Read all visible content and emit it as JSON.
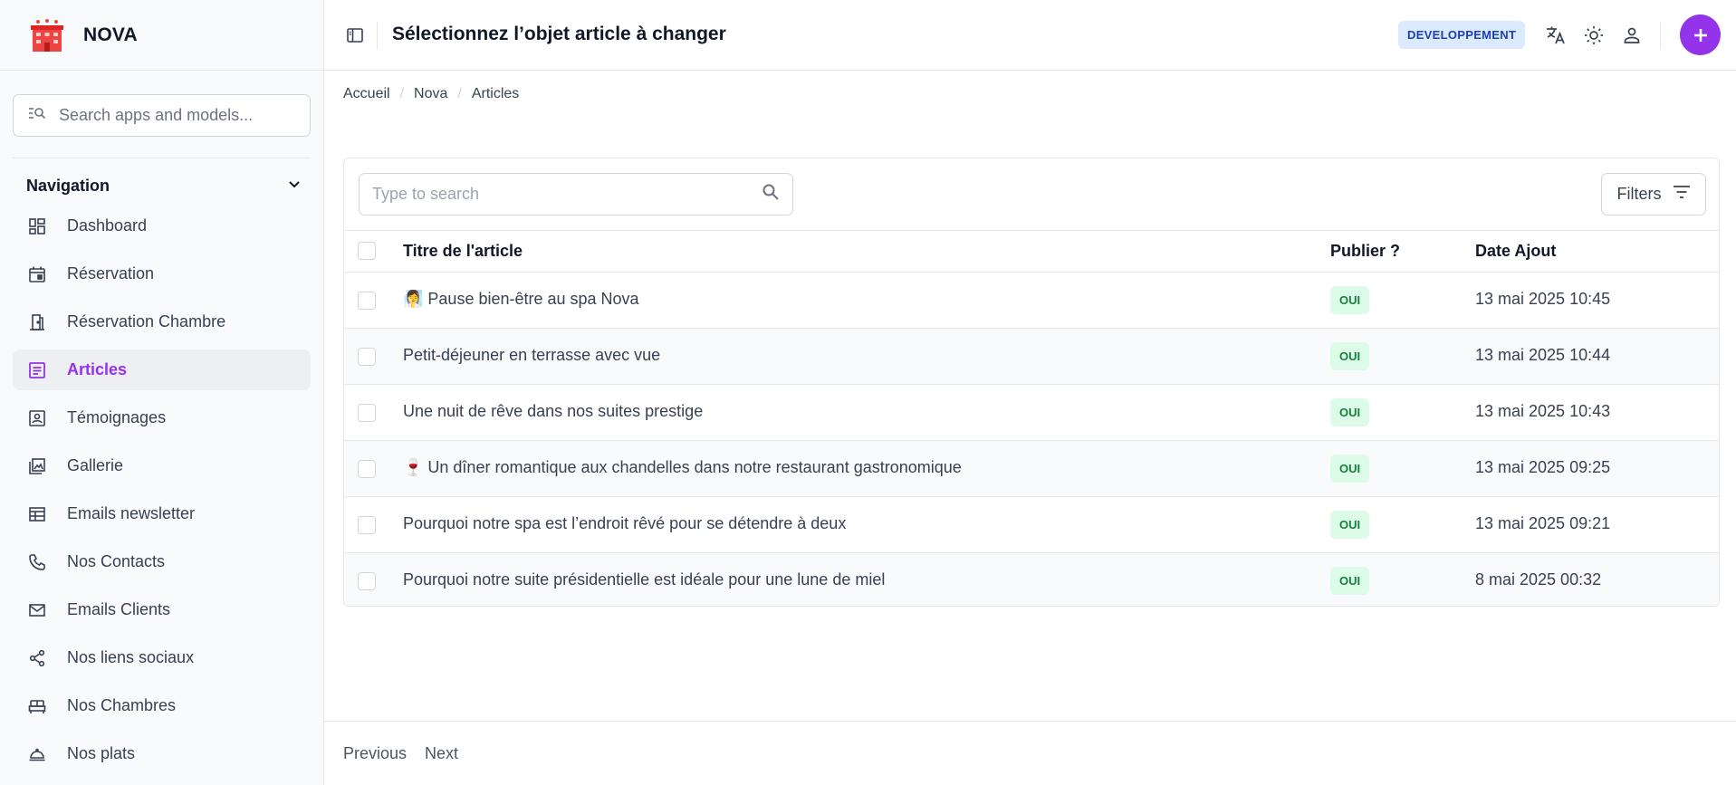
{
  "app": {
    "name": "NOVA"
  },
  "sidebar": {
    "search_placeholder": "Search apps and models...",
    "nav_heading": "Navigation",
    "items": [
      {
        "label": "Dashboard",
        "icon": "dashboard-icon",
        "active": false
      },
      {
        "label": "Réservation",
        "icon": "calendar-icon",
        "active": false
      },
      {
        "label": "Réservation Chambre",
        "icon": "door-icon",
        "active": false
      },
      {
        "label": "Articles",
        "icon": "article-icon",
        "active": true
      },
      {
        "label": "Témoignages",
        "icon": "contact-card-icon",
        "active": false
      },
      {
        "label": "Gallerie",
        "icon": "gallery-icon",
        "active": false
      },
      {
        "label": "Emails newsletter",
        "icon": "table-icon",
        "active": false
      },
      {
        "label": "Nos Contacts",
        "icon": "phone-icon",
        "active": false
      },
      {
        "label": "Emails Clients",
        "icon": "mail-icon",
        "active": false
      },
      {
        "label": "Nos liens sociaux",
        "icon": "share-icon",
        "active": false
      },
      {
        "label": "Nos Chambres",
        "icon": "bed-icon",
        "active": false
      },
      {
        "label": "Nos plats",
        "icon": "dish-icon",
        "active": false
      }
    ]
  },
  "header": {
    "title": "Sélectionnez l’objet article à changer",
    "env_badge": "DEVELOPPEMENT"
  },
  "breadcrumb": [
    "Accueil",
    "Nova",
    "Articles"
  ],
  "table": {
    "search_placeholder": "Type to search",
    "filters_label": "Filters",
    "columns": [
      "Titre de l'article",
      "Publier ?",
      "Date Ajout"
    ],
    "rows": [
      {
        "title": "🧖‍♀️ Pause bien-être au spa Nova",
        "published": "OUI",
        "date": "13 mai 2025 10:45"
      },
      {
        "title": "Petit-déjeuner en terrasse avec vue",
        "published": "OUI",
        "date": "13 mai 2025 10:44"
      },
      {
        "title": "Une nuit de rêve dans nos suites prestige",
        "published": "OUI",
        "date": "13 mai 2025 10:43"
      },
      {
        "title": "🍷 Un dîner romantique aux chandelles dans notre restaurant gastronomique",
        "published": "OUI",
        "date": "13 mai 2025 09:25"
      },
      {
        "title": "Pourquoi notre spa est l’endroit rêvé pour se détendre à deux",
        "published": "OUI",
        "date": "13 mai 2025 09:21"
      },
      {
        "title": "Pourquoi notre suite présidentielle est idéale pour une lune de miel",
        "published": "OUI",
        "date": "8 mai 2025 00:32"
      }
    ]
  },
  "pagination": {
    "previous": "Previous",
    "next": "Next"
  },
  "colors": {
    "accent": "#9333ea",
    "env_bg": "#dbeafe",
    "env_text": "#1e40af",
    "success_bg": "#dcfce7",
    "success_text": "#15803d"
  }
}
